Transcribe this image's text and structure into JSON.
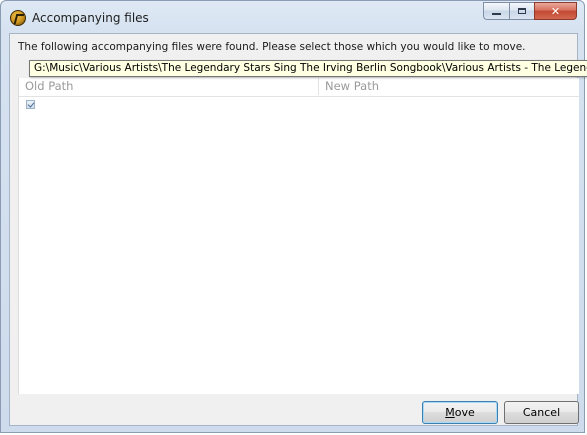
{
  "window": {
    "title": "Accompanying files",
    "app_icon": "winamp-icon",
    "caption_buttons": [
      "minimize-icon",
      "maximize-icon",
      "close-icon"
    ]
  },
  "dialog": {
    "message": "The following accompanying files were found. Please select those which you would like to move."
  },
  "list": {
    "columns": [
      "Old Path",
      "New Path"
    ],
    "rows": [
      {
        "checked": true,
        "old_path": "G:\\Music\\Various Artists\\The Legendary Stars Sing The Irving Berlin Songbook\\Various Artists - The Legendary Sta",
        "new_path": ""
      }
    ],
    "tooltip": "G:\\Music\\Various Artists\\The Legendary Stars Sing The Irving Berlin Songbook\\Various Artists - The Legendary Sta"
  },
  "buttons": {
    "move_label": "Move",
    "cancel_label": "Cancel"
  },
  "colors": {
    "tooltip_background": "#ffffe1",
    "close_button": "#c14a33",
    "default_button_border": "#3c7fb1"
  }
}
